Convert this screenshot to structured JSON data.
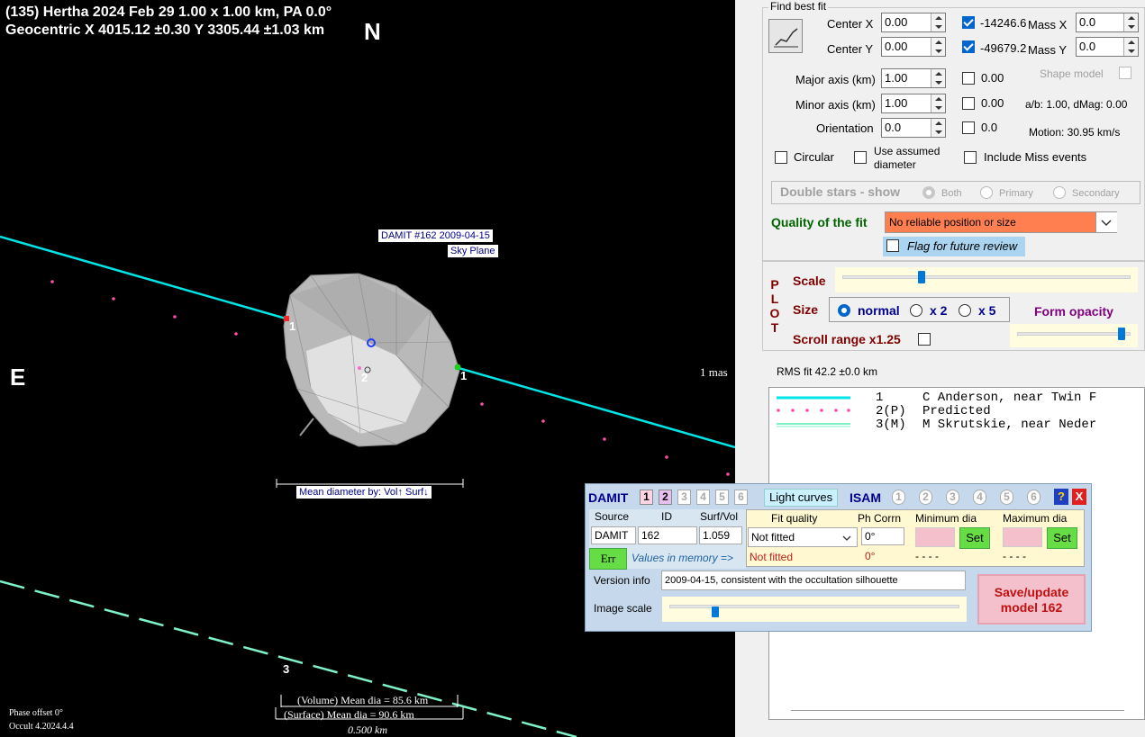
{
  "plot": {
    "title_line1": "(135) Hertha  2024 Feb 29   1.00 x 1.00 km, PA 0.0°",
    "title_line2": "Geocentric  X  4015.12 ±0.30  Y 3305.44 ±1.03 km",
    "north": "N",
    "east": "E",
    "model_label_line1": "DAMIT #162 2009-04-15",
    "model_label_line2": "Sky Plane",
    "scale_1mas": "1 mas",
    "mean_dia_label": "Mean diameter by: Vol↑ Surf↓",
    "chord1_label_a": "1",
    "chord1_label_b": "1",
    "chord2_label": "2",
    "chord3_label": "3",
    "vol_mean": "(Volume) Mean dia = 85.6 km",
    "surf_mean": "(Surface) Mean dia = 90.6 km",
    "scale_bar": "0.500 km",
    "phase_offset": "Phase offset 0°",
    "version": "Occult 4.2024.4.4",
    "colors": {
      "chord_cyan": "#00e5e5",
      "chord_dash": "#7ff2c8",
      "predicted_dots": "#ff4da6",
      "background": "#000000"
    }
  },
  "fit": {
    "title": "Find best fit",
    "center_x_label": "Center X",
    "center_x_value": "0.00",
    "center_x_result": "-14246.6",
    "center_y_label": "Center Y",
    "center_y_value": "0.00",
    "center_y_result": "-49679.2",
    "mass_x_label": "Mass X",
    "mass_x_value": "0.0",
    "mass_y_label": "Mass Y",
    "mass_y_value": "0.0",
    "major_label": "Major axis (km)",
    "major_value": "1.00",
    "major_result": "0.00",
    "minor_label": "Minor axis (km)",
    "minor_value": "1.00",
    "minor_result": "0.00",
    "orient_label": "Orientation",
    "orient_value": "0.0",
    "orient_result": "0.0",
    "shape_model_label": "Shape model",
    "ab_text": "a/b: 1.00, dMag: 0.00",
    "motion_text": "Motion: 30.95 km/s",
    "circular_label": "Circular",
    "assumed_label_1": "Use assumed",
    "assumed_label_2": "diameter",
    "miss_label": "Include Miss events"
  },
  "double_stars": {
    "label": "Double stars - show",
    "both": "Both",
    "primary": "Primary",
    "secondary": "Secondary"
  },
  "quality": {
    "label": "Quality of the fit",
    "selected": "No reliable position or size",
    "flag_label": "Flag for future review"
  },
  "plot_ctrl": {
    "plot_letters": [
      "P",
      "L",
      "O",
      "T"
    ],
    "scale_label": "Scale",
    "size_label": "Size",
    "normal": "normal",
    "x2": "x 2",
    "x5": "x 5",
    "form_opacity": "Form opacity",
    "scroll_range": "Scroll range x1.25",
    "scale_level": 0.27,
    "opacity_level": 0.95
  },
  "rms": "RMS fit 42.2 ±0.0 km",
  "legend": {
    "rows": [
      {
        "num": "1",
        "text": "C Anderson, near Twin F"
      },
      {
        "num": "2(P)",
        "text": "Predicted"
      },
      {
        "num": "3(M)",
        "text": "M Skrutskie, near Neder"
      }
    ]
  },
  "damit": {
    "title": "DAMIT",
    "tabs": [
      "1",
      "2",
      "3",
      "4",
      "5",
      "6"
    ],
    "light_curves": "Light curves",
    "isam": "ISAM",
    "isam_tabs": [
      "1",
      "2",
      "3",
      "4",
      "5",
      "6"
    ],
    "help": "?",
    "close": "X",
    "source_hdr": "Source",
    "id_hdr": "ID",
    "surf_hdr": "Surf/Vol",
    "source_val": "DAMIT",
    "id_val": "162",
    "surf_val": "1.059",
    "err_btn": "Err",
    "values_mem": "Values in memory =>",
    "fit_quality_hdr": "Fit quality",
    "fit_quality_val": "Not fitted",
    "fit_quality_mem": "Not fitted",
    "ph_corr_hdr": "Ph Corrn",
    "ph_corr_val": "0°",
    "ph_corr_mem": "0°",
    "min_dia_hdr": "Minimum dia",
    "max_dia_hdr": "Maximum dia",
    "set1": "Set",
    "set2": "Set",
    "min_mem": "- - - -",
    "max_mem": "- - - -",
    "version_label": "Version info",
    "version_val": "2009-04-15, consistent with the occultation silhouette",
    "image_scale_label": "Image scale",
    "image_scale_level": 0.15,
    "save_btn_1": "Save/update",
    "save_btn_2": "model 162"
  }
}
